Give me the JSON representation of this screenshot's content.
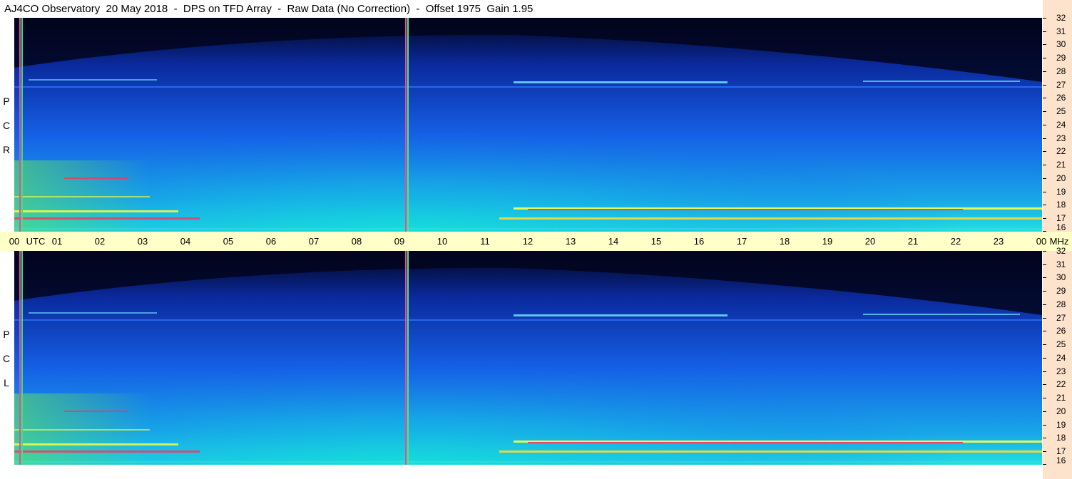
{
  "title": "AJ4CO Observatory  20 May 2018  -  DPS on TFD Array  -  Raw Data (No Correction)  -  Offset 1975  Gain 1.95",
  "top_panel": {
    "polarization_letters": [
      "P",
      "C",
      "R"
    ]
  },
  "bottom_panel": {
    "polarization_letters": [
      "P",
      "C",
      "L"
    ]
  },
  "frequency_axis": {
    "unit": "MHz",
    "labels": [
      "32",
      "31",
      "30",
      "29",
      "28",
      "27",
      "26",
      "25",
      "24",
      "23",
      "22",
      "21",
      "20",
      "19",
      "18",
      "17",
      "16"
    ]
  },
  "time_axis": {
    "unit": "UTC",
    "labels": [
      "00",
      "01",
      "02",
      "03",
      "04",
      "05",
      "06",
      "07",
      "08",
      "09",
      "10",
      "11",
      "12",
      "13",
      "14",
      "15",
      "16",
      "17",
      "18",
      "19",
      "20",
      "21",
      "22",
      "23",
      "00"
    ],
    "end_unit": "MHz"
  },
  "colors": {
    "night": "#02051c",
    "deep_blue": "#0b2a9e",
    "mid_blue": "#1560e6",
    "cyan": "#10d6e6",
    "yellow": "#ffff40",
    "red": "#ff3060",
    "time_axis_bg": "#ffffc8",
    "right_strip_bg": "#fde2cc"
  }
}
